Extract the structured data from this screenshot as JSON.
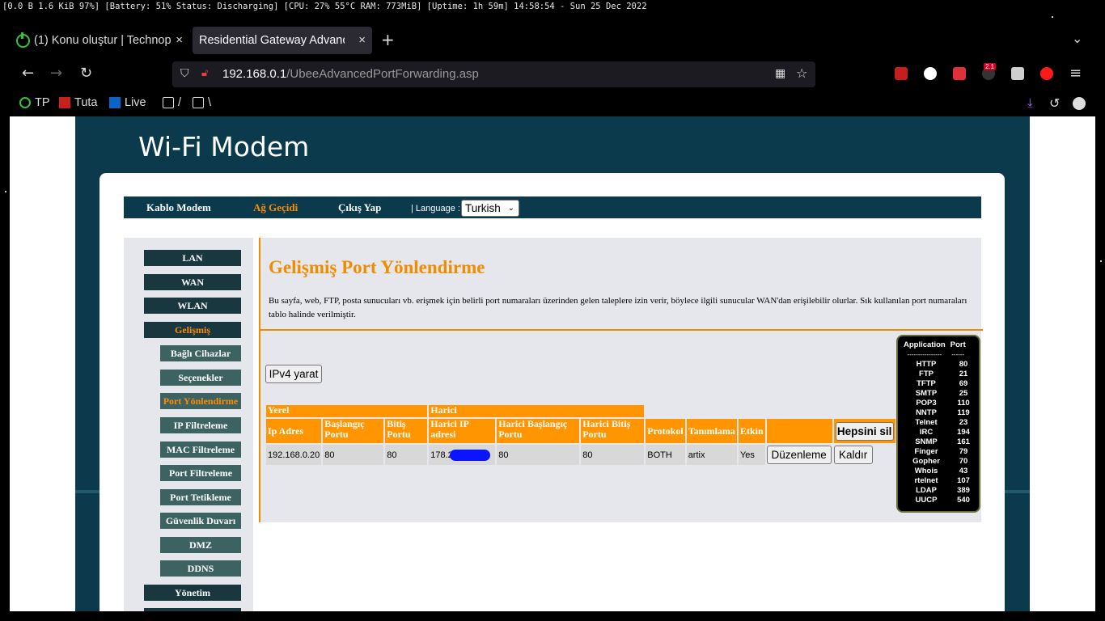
{
  "status_bar": {
    "text": "[0.0 B 1.6 KiB 97%] [Battery: 51% Status: Discharging] [CPU: 27% 55°C RAM: 773MiB] [Uptime: 1h 59m] 14:58:54 - Sun 25 Dec 2022"
  },
  "tabs": [
    {
      "label": "(1) Konu oluştur | Technop",
      "close": "×"
    },
    {
      "label": "Residential Gateway Advance",
      "close": "×"
    }
  ],
  "toolbar": {
    "new_tab": "+",
    "overflow": "⌄",
    "back": "←",
    "forward": "→",
    "reload": "↻",
    "menu": "≡"
  },
  "url": {
    "host": "192.168.0.1",
    "path": "/UbeeAdvancedPortForwarding.asp"
  },
  "extensions": {
    "counter_badge": "2.1"
  },
  "bookmarks": [
    {
      "label": "TP"
    },
    {
      "label": "Tuta"
    },
    {
      "label": "Live"
    },
    {
      "label": "/"
    },
    {
      "label": "\\"
    }
  ],
  "site": {
    "title": "Wi-Fi Modem",
    "topnav": {
      "cable_modem": "Kablo Modem",
      "gateway": "Ağ Geçidi",
      "logout": "Çıkış Yap",
      "language_label": "| Language :",
      "language_value": "Turkish"
    }
  },
  "sidebar": {
    "lan": "LAN",
    "wan": "WAN",
    "wlan": "WLAN",
    "advanced": "Gelişmiş",
    "sub": {
      "connected": "Bağlı Cihazlar",
      "options": "Seçenekler",
      "port_forwarding": "Port Yönlendirme",
      "ip_filter": "IP Filtreleme",
      "mac_filter": "MAC Filtreleme",
      "port_filter": "Port Filtreleme",
      "port_trigger": "Port Tetikleme",
      "firewall": "Güvenlik Duvarı",
      "dmz": "DMZ",
      "ddns": "DDNS"
    },
    "management": "Yönetim"
  },
  "main": {
    "heading": "Gelişmiş Port Yönlendirme",
    "description": "Bu sayfa, web, FTP, posta sunucuları vb. erişmek için belirli port numaraları üzerinden gelen taleplere izin verir, böylece ilgili sunucular WAN'dan erişilebilir olurlar. Sık kullanılan port numaraları tablo halinde verilmiştir.",
    "create_ipv4": "IPv4 yarat"
  },
  "table": {
    "group_local": "Yerel",
    "group_external": "Harici",
    "headers": {
      "ip": "Ip Adres",
      "start_port": "Başlangıç Portu",
      "end_port": "Bitiş Portu",
      "ext_ip": "Harici IP adresi",
      "ext_start": "Harici Başlangıç Portu",
      "ext_end": "Harici Bitiş Portu",
      "protocol": "Protokol",
      "description": "Tanımlama",
      "enabled": "Etkin"
    },
    "delete_all": "Hepsini sil",
    "row": {
      "ip": "192.168.0.20",
      "start_port": "80",
      "end_port": "80",
      "ext_ip": "178.2",
      "ext_start": "80",
      "ext_end": "80",
      "protocol": "BOTH",
      "description": "artix",
      "enabled": "Yes",
      "edit": "Düzenleme",
      "remove": "Kaldır"
    }
  },
  "app_ports": {
    "header_app": "Application",
    "header_port": "Port",
    "sep_app": "----------------",
    "sep_port": "------",
    "rows": [
      [
        "HTTP",
        "80"
      ],
      [
        "FTP",
        "21"
      ],
      [
        "TFTP",
        "69"
      ],
      [
        "SMTP",
        "25"
      ],
      [
        "POP3",
        "110"
      ],
      [
        "NNTP",
        "119"
      ],
      [
        "Telnet",
        "23"
      ],
      [
        "IRC",
        "194"
      ],
      [
        "SNMP",
        "161"
      ],
      [
        "Finger",
        "79"
      ],
      [
        "Gopher",
        "70"
      ],
      [
        "Whois",
        "43"
      ],
      [
        "rtelnet",
        "107"
      ],
      [
        "LDAP",
        "389"
      ],
      [
        "UUCP",
        "540"
      ]
    ]
  }
}
